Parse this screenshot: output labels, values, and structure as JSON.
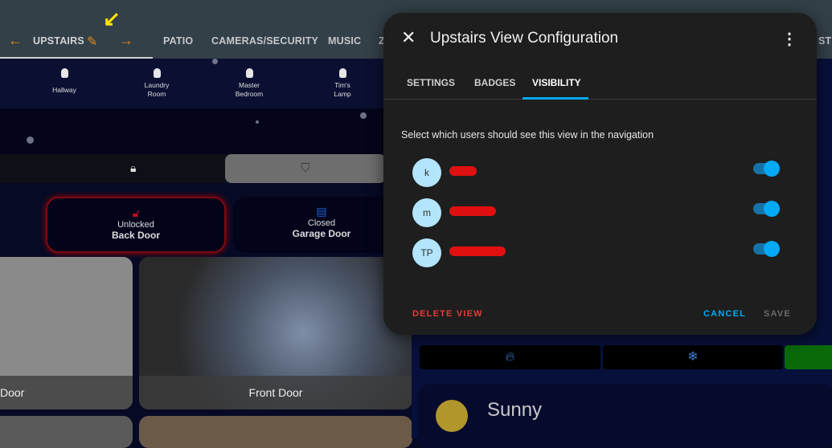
{
  "header": {
    "tabs": [
      {
        "label": "UPSTAIRS",
        "active": true
      },
      {
        "label": "PATIO"
      },
      {
        "label": "CAMERAS/SECURITY"
      },
      {
        "label": "MUSIC"
      },
      {
        "label": "Z"
      }
    ],
    "right_fragment": "STE"
  },
  "lights": [
    {
      "label": "Hallway"
    },
    {
      "label": "Laundry Room"
    },
    {
      "label": "Master Bedroom"
    },
    {
      "label": "Tim's Lamp"
    }
  ],
  "doors": [
    {
      "state": "Unlocked",
      "name": "Back Door",
      "color": "#c0111a"
    },
    {
      "state": "Closed",
      "name": "Garage Door",
      "color": "#1e5fd0"
    }
  ],
  "cameras": [
    {
      "label": "Door"
    },
    {
      "label": "Front Door"
    }
  ],
  "weather": {
    "condition": "Sunny"
  },
  "dialog": {
    "title": "Upstairs View Configuration",
    "tabs": [
      {
        "label": "SETTINGS"
      },
      {
        "label": "BADGES"
      },
      {
        "label": "VISIBILITY",
        "active": true
      }
    ],
    "description": "Select which users should see this view in the navigation",
    "users": [
      {
        "initials": "k",
        "visible": true
      },
      {
        "initials": "m",
        "visible": true
      },
      {
        "initials": "TP",
        "visible": true
      }
    ],
    "delete_label": "DELETE VIEW",
    "cancel_label": "CANCEL",
    "save_label": "SAVE",
    "accent": "#03a9f4",
    "danger": "#e53935"
  }
}
